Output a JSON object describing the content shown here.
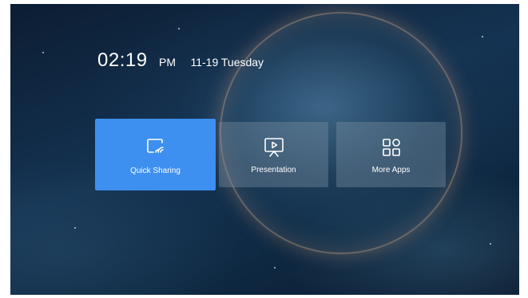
{
  "clock": {
    "time": "02:19",
    "ampm": "PM",
    "date": "11-19 Tuesday"
  },
  "tiles": [
    {
      "label": "Quick Sharing",
      "icon": "cast-icon",
      "selected": true,
      "color": "#3d8ff0"
    },
    {
      "label": "Presentation",
      "icon": "presentation-icon",
      "selected": false
    },
    {
      "label": "More Apps",
      "icon": "apps-grid-icon",
      "selected": false
    }
  ]
}
